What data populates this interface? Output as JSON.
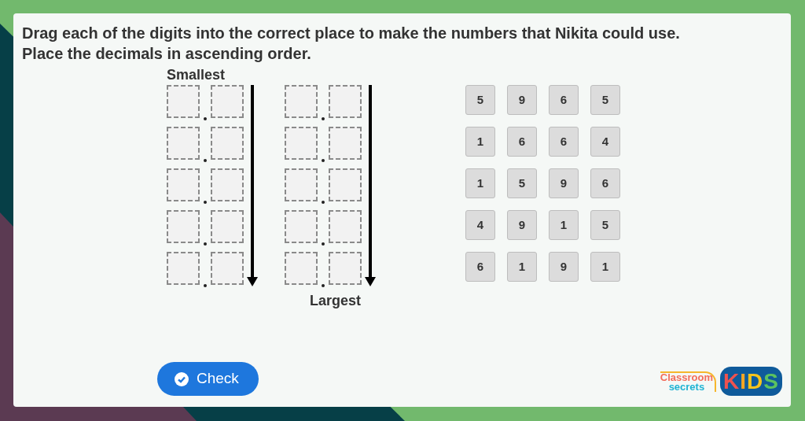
{
  "instruction": "Drag each of the digits into the correct place to make the numbers that Nikita could use.",
  "instruction_2": "Place the decimals in ascending order.",
  "smallest_label": "Smallest",
  "largest_label": "Largest",
  "answer_columns": [
    {
      "slots": [
        {
          "filled": false
        },
        {
          "filled": false
        },
        {
          "filled": false
        },
        {
          "filled": false
        },
        {
          "filled": false
        }
      ]
    },
    {
      "slots": [
        {
          "filled": false
        },
        {
          "filled": false
        },
        {
          "filled": false
        },
        {
          "filled": false
        },
        {
          "filled": false
        }
      ]
    }
  ],
  "digit_rows": [
    [
      "5",
      "9",
      "6",
      "5"
    ],
    [
      "1",
      "6",
      "6",
      "4"
    ],
    [
      "1",
      "5",
      "9",
      "6"
    ],
    [
      "4",
      "9",
      "1",
      "5"
    ],
    [
      "6",
      "1",
      "9",
      "1"
    ]
  ],
  "check_button": {
    "label": "Check"
  },
  "logo": {
    "line_1": "Classroom",
    "line_2": "secrets",
    "badge": "KIDS"
  }
}
